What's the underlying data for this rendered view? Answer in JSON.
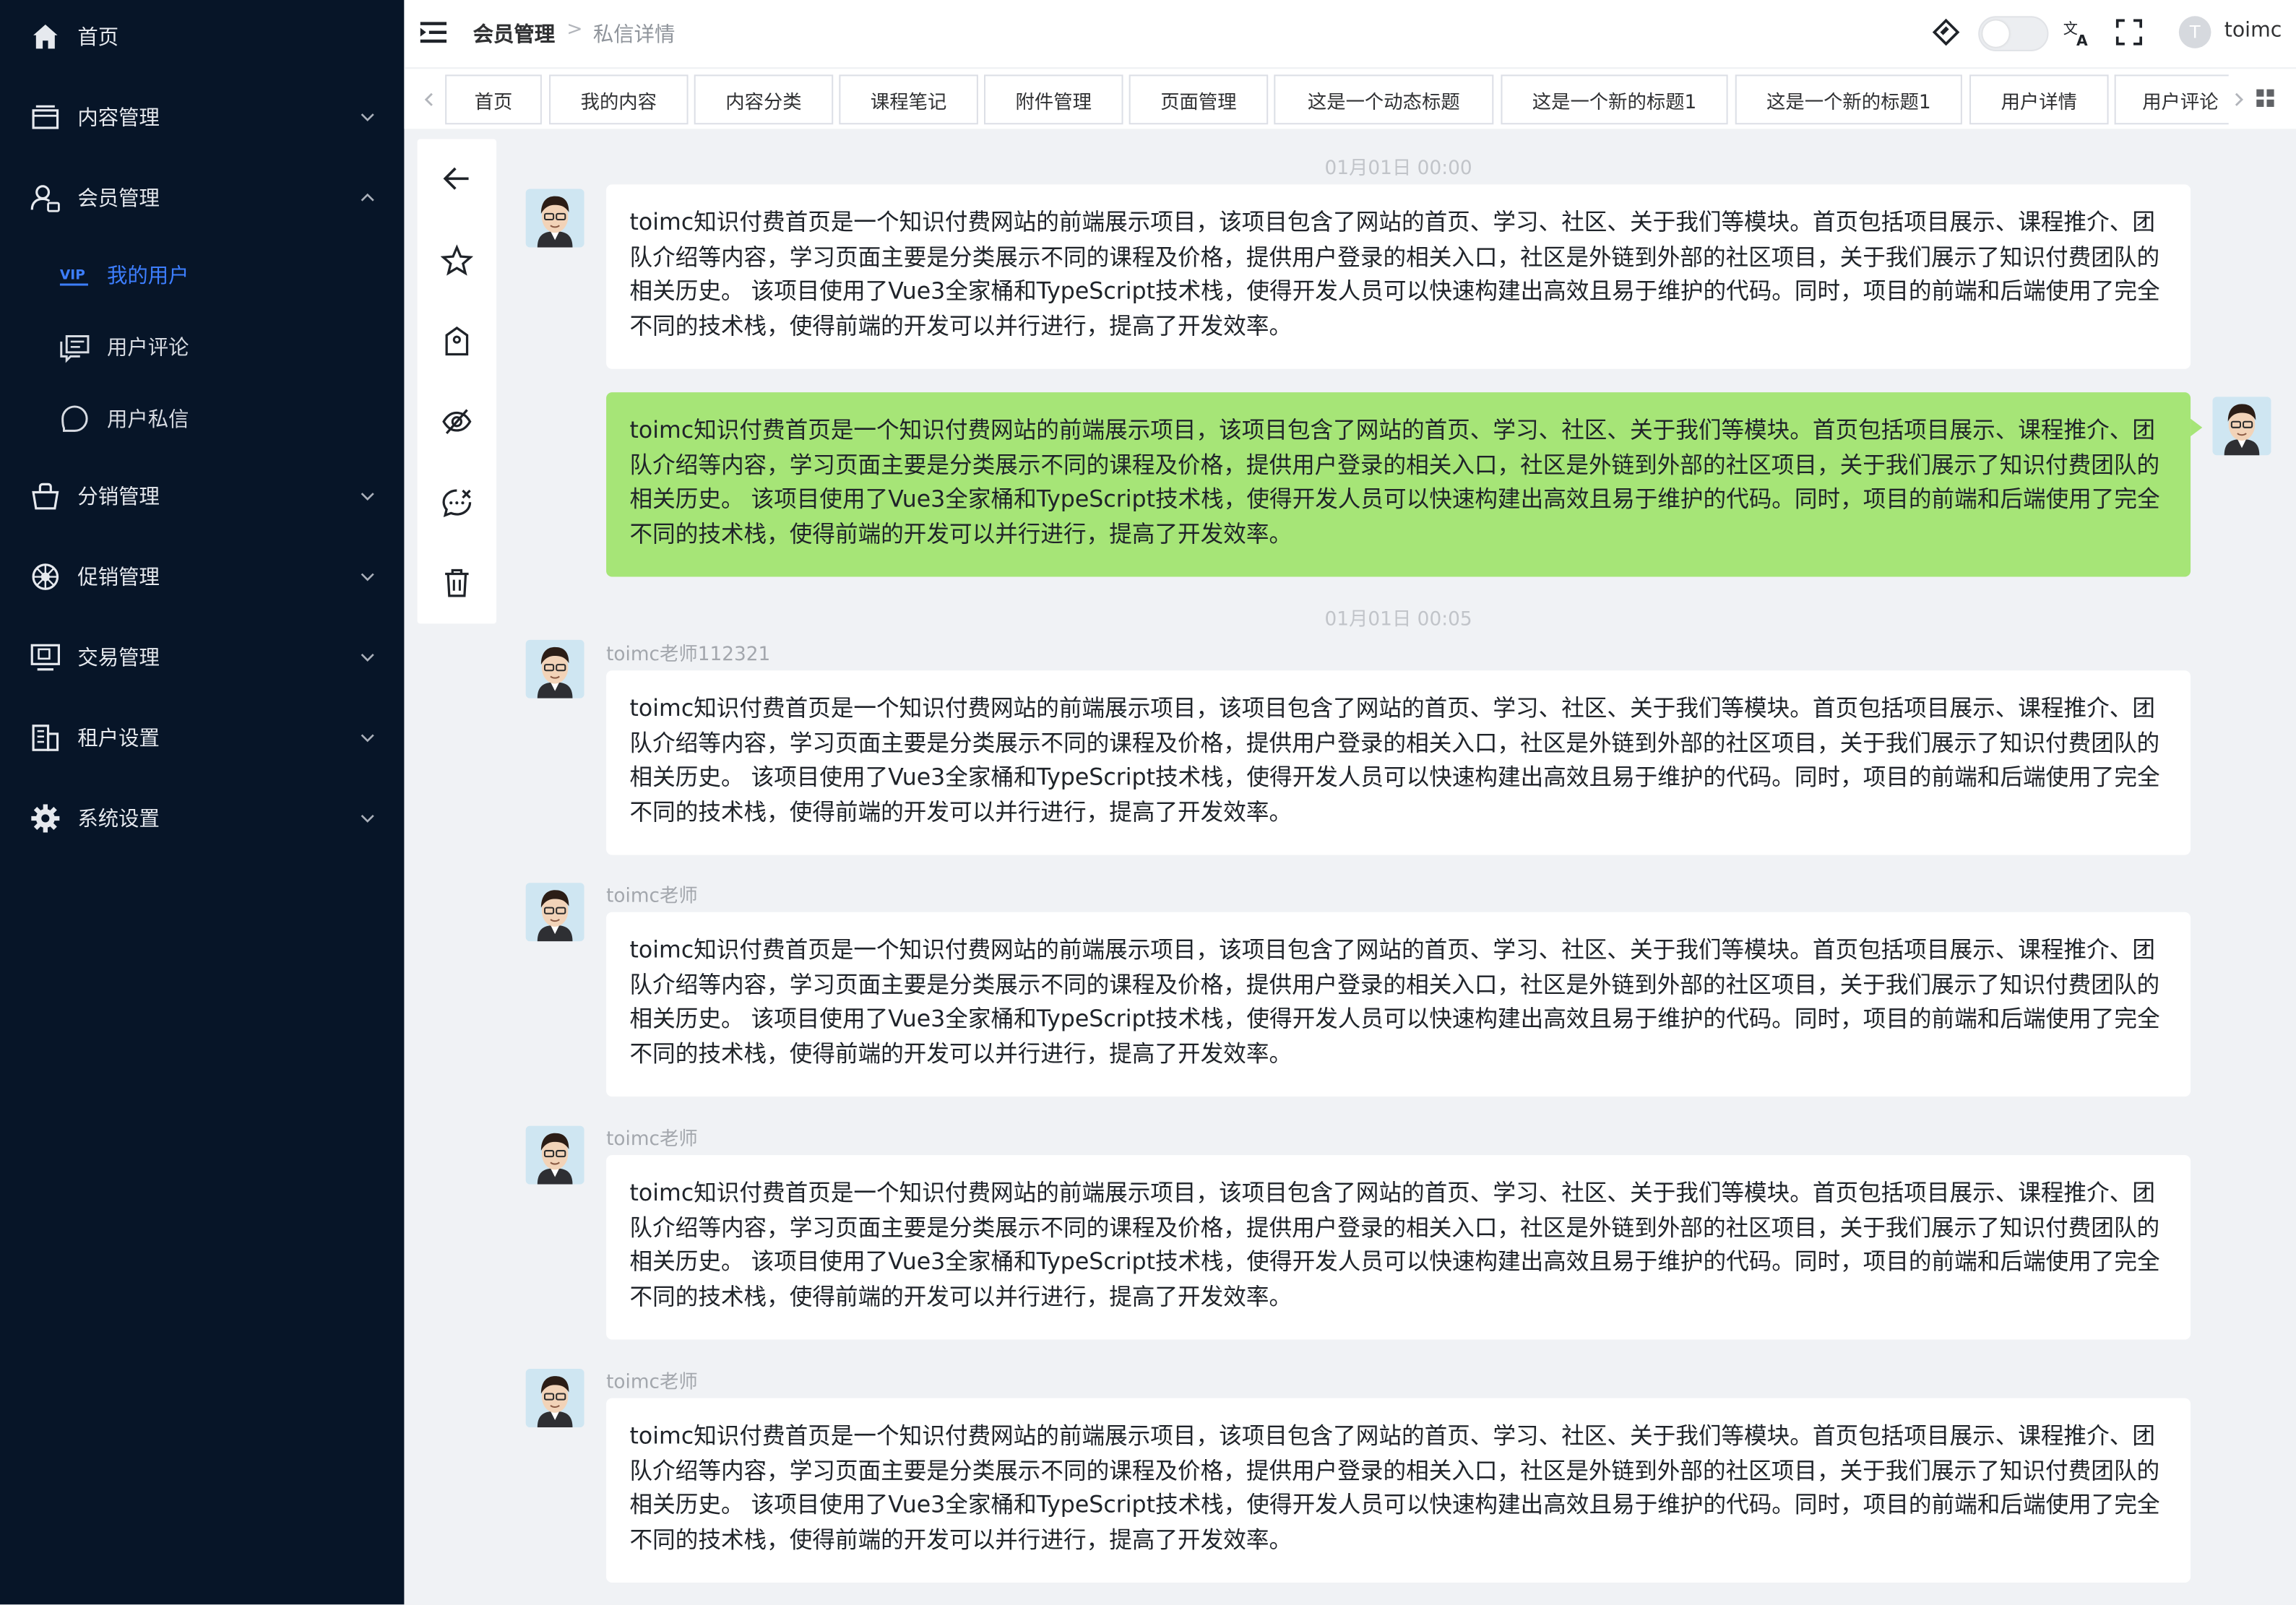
{
  "sidebar": {
    "items": [
      {
        "label": "首页",
        "icon": "home-icon"
      },
      {
        "label": "内容管理",
        "icon": "content-icon"
      },
      {
        "label": "会员管理",
        "icon": "member-icon"
      },
      {
        "label": "分销管理",
        "icon": "bag-icon"
      },
      {
        "label": "促销管理",
        "icon": "wheel-icon"
      },
      {
        "label": "交易管理",
        "icon": "monitor-icon"
      },
      {
        "label": "租户设置",
        "icon": "building-icon"
      },
      {
        "label": "系统设置",
        "icon": "gear-icon"
      }
    ],
    "sub_items": [
      {
        "label": "我的用户",
        "icon": "vip-icon",
        "active": true
      },
      {
        "label": "用户评论",
        "icon": "comment-icon"
      },
      {
        "label": "用户私信",
        "icon": "message-icon"
      }
    ],
    "background": "#071528",
    "active_color": "#3d7eff"
  },
  "header": {
    "breadcrumb": [
      "会员管理",
      "私信详情"
    ],
    "user_initial": "T",
    "username": "toimc"
  },
  "tabs": [
    "首页",
    "我的内容",
    "内容分类",
    "课程笔记",
    "附件管理",
    "页面管理",
    "这是一个动态标题",
    "这是一个新的标题1",
    "这是一个新的标题1",
    "用户详情",
    "用户评论"
  ],
  "messages": {
    "text": "toimc知识付费首页是一个知识付费网站的前端展示项目，该项目包含了网站的首页、学习、社区、关于我们等模块。首页包括项目展示、课程推介、团队介绍等内容，学习页面主要是分类展示不同的课程及价格，提供用户登录的相关入口，社区是外链到外部的社区项目，关于我们展示了知识付费团队的相关历史。 该项目使用了Vue3全家桶和TypeScript技术栈，使得开发人员可以快速构建出高效且易于维护的代码。同时，项目的前端和后端使用了完全不同的技术栈，使得前端的开发可以并行进行，提高了开发效率。",
    "time1": "01月01日 00:00",
    "time2": "01月01日 00:05",
    "sender1": "toimc老师112321",
    "sender2": "toimc老师",
    "mine_color": "#a6e577"
  }
}
